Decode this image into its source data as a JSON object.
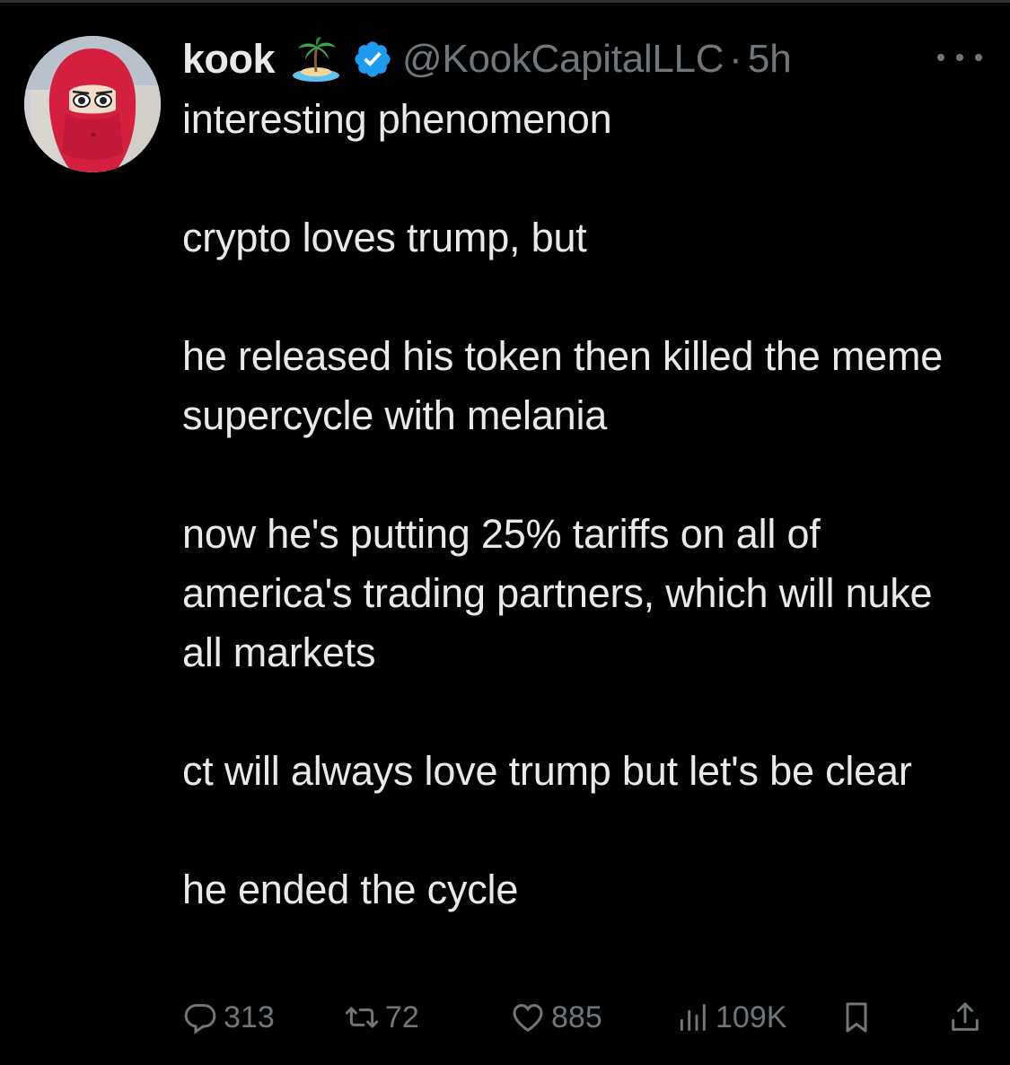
{
  "author": {
    "display_name": "kook",
    "name_emoji": "island-emoji",
    "verified_icon": "verified-badge-icon",
    "handle": "@KookCapitalLLC",
    "separator": "·",
    "time": "5h",
    "avatar": "avatar-red-hijab-cartoon"
  },
  "tweet": {
    "paragraphs": [
      "interesting phenomenon",
      "crypto loves trump, but",
      "he released his token then killed the meme supercycle with melania",
      "now he's putting 25% tariffs on all of america's trading partners, which will nuke all markets",
      "ct will always love trump but let's be clear",
      "he ended the cycle"
    ]
  },
  "actions": {
    "replies": "313",
    "reposts": "72",
    "likes": "885",
    "views": "109K"
  },
  "colors": {
    "background": "#000000",
    "text": "#e7e9ea",
    "muted": "#71767b",
    "verified": "#1d9bf0"
  }
}
